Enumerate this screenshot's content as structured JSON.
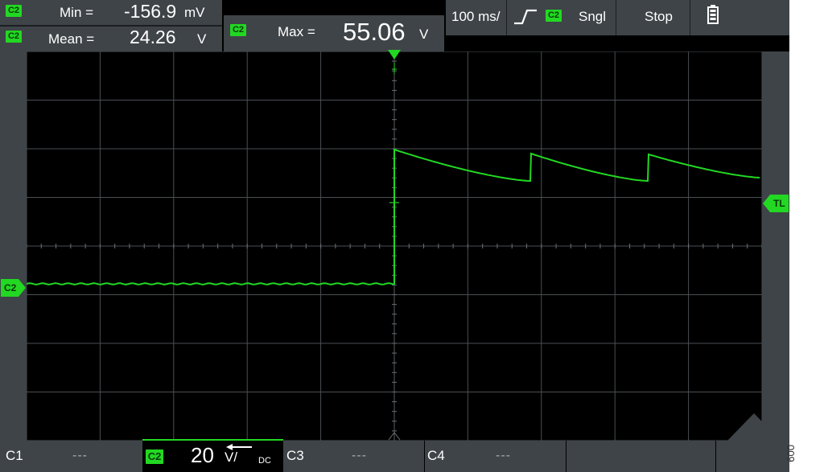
{
  "measurements": {
    "min": {
      "channel": "C2",
      "label": "Min =",
      "value": "-156.9",
      "unit": "mV"
    },
    "mean": {
      "channel": "C2",
      "label": "Mean =",
      "value": "24.26",
      "unit": "V"
    },
    "max": {
      "channel": "C2",
      "label": "Max =",
      "value": "55.06",
      "unit": "V"
    }
  },
  "timebase": "100 ms/",
  "trigger": {
    "channel": "C2",
    "mode": "Sngl"
  },
  "run_state": "Stop",
  "markers": {
    "trigger_level": "TL",
    "channel_ref": "C2"
  },
  "bottom_bar": {
    "c1": {
      "label": "C1",
      "value": "---"
    },
    "c2": {
      "label": "C2",
      "scale": "20",
      "unit": "V/",
      "coupling": "DC"
    },
    "c3": {
      "label": "C3",
      "value": "---"
    },
    "c4": {
      "label": "C4",
      "value": "---"
    }
  },
  "side_note": "009",
  "colors": {
    "trace": "#22d822",
    "chip": "#22d822",
    "panel": "#3f4448"
  }
}
